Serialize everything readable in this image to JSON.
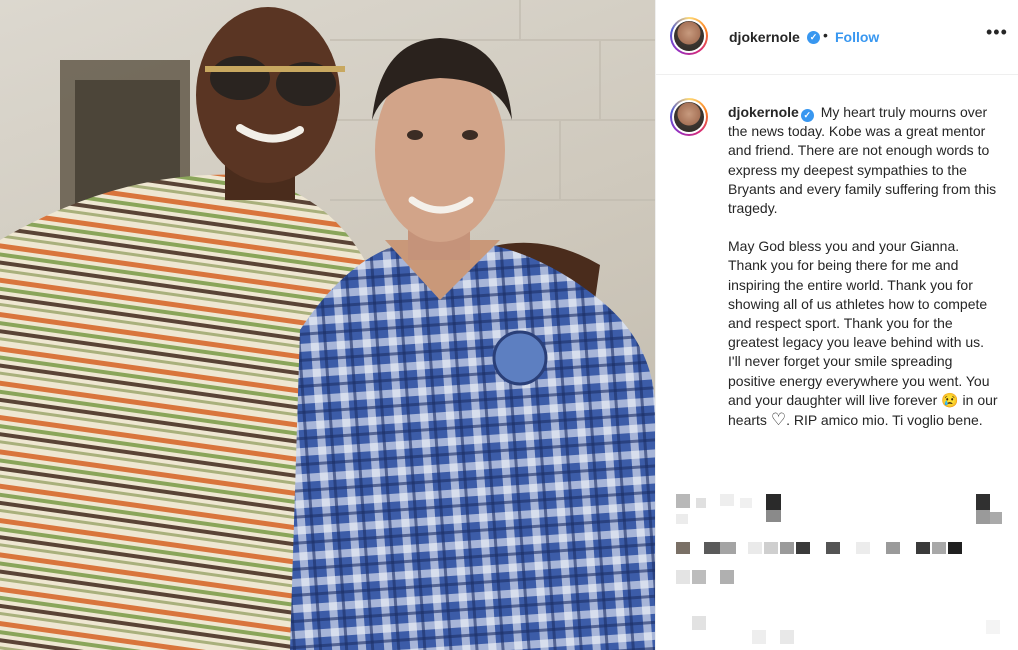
{
  "post": {
    "username": "djokernole",
    "separator": "•",
    "follow_label": "Follow",
    "more_icon": "more-options-icon"
  },
  "caption": {
    "username": "djokernole",
    "paragraph1": "My heart truly mourns over the news today. Kobe was a great mentor and friend. There are not enough words to express my deepest sympathies to the Bryants and every family suffering from this tragedy.",
    "paragraph2_part1": "May God bless you and your Gianna. Thank you for being there for me and inspiring the entire world. Thank you for showing all of us athletes how to compete and respect sport. Thank you for the greatest legacy you leave behind with us. I'll never forget your smile spreading positive energy everywhere you went. You and your daughter will live forever 😢 in our hearts",
    "heart": "♡",
    "paragraph2_part2": ". RIP amico mio. Ti voglio bene."
  },
  "colors": {
    "link_blue": "#3897f0",
    "text": "#262626",
    "border": "#efefef"
  }
}
